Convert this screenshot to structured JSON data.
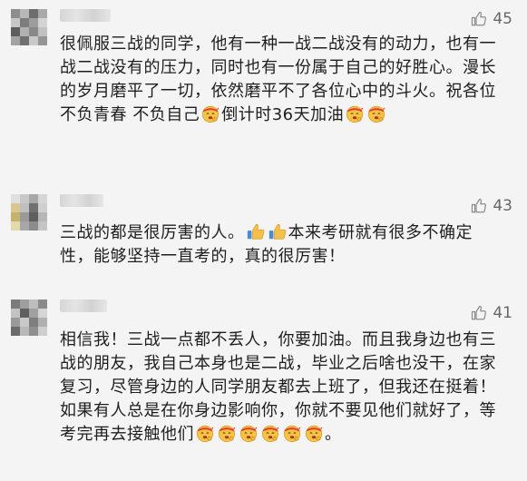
{
  "comments": [
    {
      "likes": "45",
      "parts": [
        {
          "t": "text",
          "v": "很佩服三战的同学，他有一种一战二战没有的动力，也有一战二战没有的压力，同时也有一份属于自己的好胜心。漫长的岁月磨平了一切，依然磨平不了各位心中的斗火。祝各位不负青春 不负自己"
        },
        {
          "t": "emoji",
          "v": "fighting-emoji"
        },
        {
          "t": "text",
          "v": "倒计时36天加油"
        },
        {
          "t": "emoji",
          "v": "fighting-emoji"
        },
        {
          "t": "emoji",
          "v": "fighting-emoji"
        }
      ]
    },
    {
      "likes": "43",
      "parts": [
        {
          "t": "text",
          "v": "三战的都是很厉害的人。"
        },
        {
          "t": "thumb",
          "v": "thumbs-up-emoji"
        },
        {
          "t": "thumb",
          "v": "thumbs-up-emoji"
        },
        {
          "t": "text",
          "v": "本来考研就有很多不确定性，能够坚持一直考的，真的很厉害！"
        }
      ]
    },
    {
      "likes": "41",
      "parts": [
        {
          "t": "text",
          "v": "相信我！三战一点都不丢人，你要加油。而且我身边也有三战的朋友，我自己本身也是二战，毕业之后啥也没干，在家复习，尽管身边的人同学朋友都去上班了，但我还在挺着！如果有人总是在你身边影响你，你就不要见他们就好了，等考完再去接触他们"
        },
        {
          "t": "emoji",
          "v": "fighting-emoji"
        },
        {
          "t": "emoji",
          "v": "fighting-emoji"
        },
        {
          "t": "emoji",
          "v": "fighting-emoji"
        },
        {
          "t": "emoji",
          "v": "fighting-emoji"
        },
        {
          "t": "emoji",
          "v": "fighting-emoji"
        },
        {
          "t": "emoji",
          "v": "fighting-emoji"
        },
        {
          "t": "text",
          "v": "。"
        }
      ]
    }
  ],
  "colors": {
    "background": "#f4f4f4",
    "text": "#1e1e1e",
    "like_count": "#666666",
    "like_icon": "#888888"
  }
}
